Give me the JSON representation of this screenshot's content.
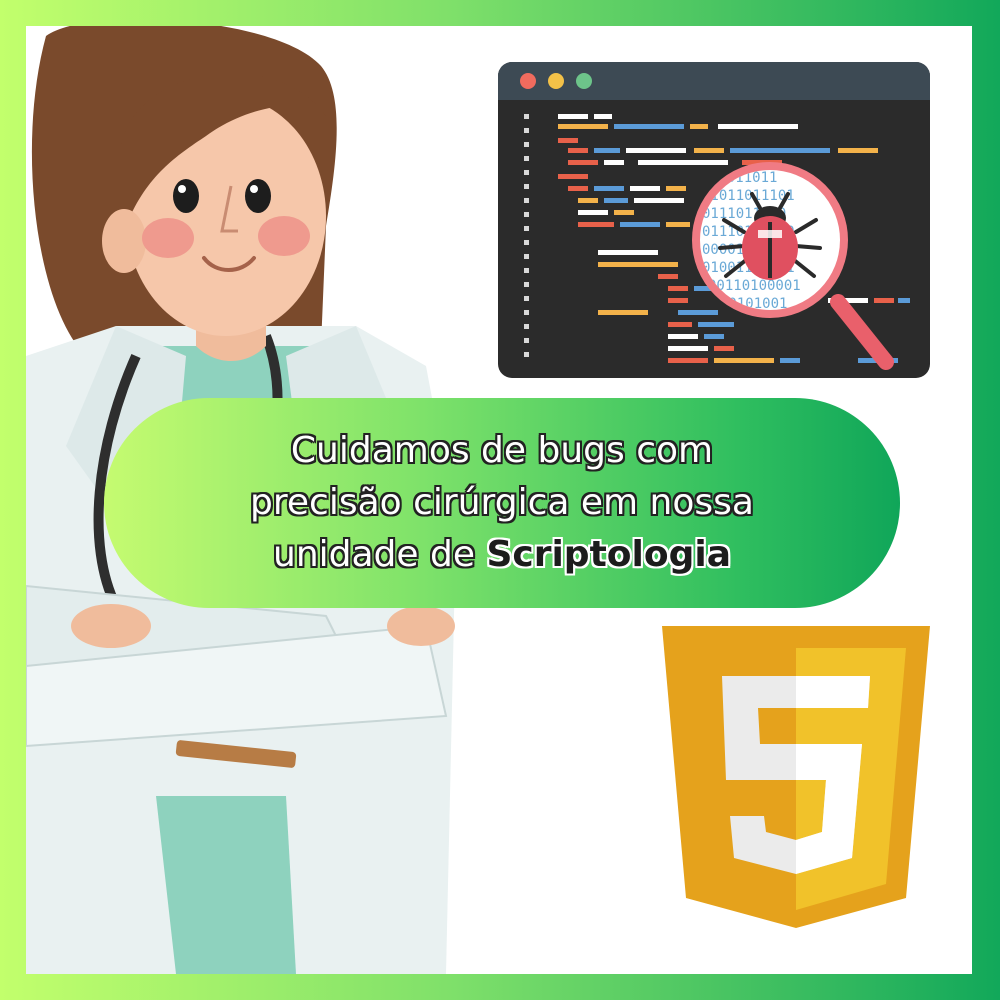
{
  "banner": {
    "line1": "Cuidamos de bugs com",
    "line2": "precisão cirúrgica em nossa",
    "line3_prefix": "unidade de ",
    "line3_bold": "Scriptologia"
  },
  "editor": {
    "binary_lines": [
      "00011011",
      "01011011101",
      "0111011010",
      "01110111010",
      "0000110011",
      "01001110001",
      "00110100001",
      "00101001"
    ]
  },
  "icons": {
    "editor": "code-editor-window",
    "bug": "bug-icon",
    "magnifier": "magnifying-glass-icon",
    "shield": "javascript-shield-icon"
  },
  "colors": {
    "frame_left": "#c2ff6c",
    "frame_right": "#12a85a",
    "editor_bg": "#2b2b2b",
    "editor_titlebar": "#3d4a54",
    "bug": "#e05060",
    "shield_dark": "#e5a21c",
    "shield_light": "#f1c22a"
  }
}
